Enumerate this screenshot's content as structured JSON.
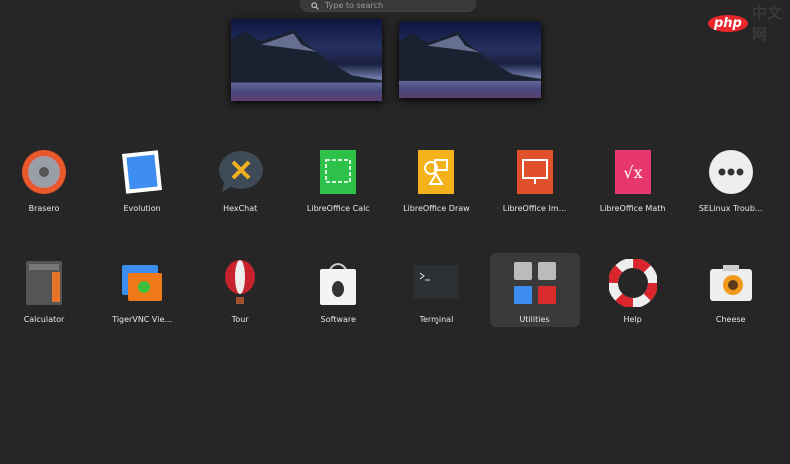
{
  "search": {
    "placeholder": "Type to search",
    "icon": "search-icon"
  },
  "watermark": {
    "text": "php中文网"
  },
  "workspaces": [
    {
      "name": "workspace-1"
    },
    {
      "name": "workspace-2"
    }
  ],
  "apps": [
    {
      "label": "Brasero",
      "icon": "brasero-icon"
    },
    {
      "label": "Evolution",
      "icon": "evolution-icon"
    },
    {
      "label": "HexChat",
      "icon": "hexchat-icon"
    },
    {
      "label": "LibreOffice Calc",
      "icon": "libreoffice-calc-icon"
    },
    {
      "label": "LibreOffice Draw",
      "icon": "libreoffice-draw-icon"
    },
    {
      "label": "LibreOffice Im...",
      "icon": "libreoffice-impress-icon"
    },
    {
      "label": "LibreOffice Math",
      "icon": "libreoffice-math-icon"
    },
    {
      "label": "SELinux Troub...",
      "icon": "selinux-icon"
    },
    {
      "label": "Calculator",
      "icon": "calculator-icon"
    },
    {
      "label": "TigerVNC Vie...",
      "icon": "tigervnc-icon"
    },
    {
      "label": "Tour",
      "icon": "tour-balloon-icon"
    },
    {
      "label": "Software",
      "icon": "software-icon"
    },
    {
      "label": "Terminal",
      "icon": "terminal-icon"
    },
    {
      "label": "Utilities",
      "icon": "folder-utilities-icon",
      "selected": true
    },
    {
      "label": "Help",
      "icon": "help-lifebuoy-icon"
    },
    {
      "label": "Cheese",
      "icon": "cheese-camera-icon"
    }
  ]
}
